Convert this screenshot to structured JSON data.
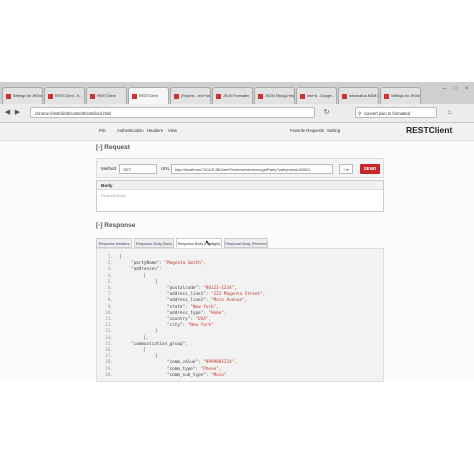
{
  "browser": {
    "tabs": [
      {
        "label": "Settings for JROdem"
      },
      {
        "label": "RESTClient - fi..."
      },
      {
        "label": "RESTClient"
      },
      {
        "label": "RESTClient"
      },
      {
        "label": "(Rs)sms - rest+hasin"
      },
      {
        "label": "JSON Formatter"
      },
      {
        "label": "JSON Strong-Help"
      },
      {
        "label": "rest+d - Google..."
      },
      {
        "label": "Informatica MDM Hub"
      },
      {
        "label": "Settings for JROdem"
      }
    ],
    "url": "chrome://restclient/content/restclient.html",
    "search": "convert json to formatted"
  },
  "appbar": {
    "menus": [
      "File",
      "Authentication",
      "Headers",
      "View"
    ],
    "right_menus": [
      "Favorite Requests",
      "Setting"
    ],
    "brand": "RESTClient"
  },
  "request": {
    "section_title": "[-] Request",
    "method_label": "Method",
    "method_value": "GET",
    "url_label": "URL",
    "url_value": "http://localhost:7001/EJBClientTest/rest/services/getParty?partyrowid=60001",
    "send_label": "SEND",
    "body_label": "Body",
    "body_placeholder": "Request Body"
  },
  "response": {
    "section_title": "[-] Response",
    "tabs": [
      "Response Headers",
      "Response Body (Raw)",
      "Response Body (Highlight)",
      "Response Body (Preview)"
    ],
    "active_tab": 2,
    "lines": [
      {
        "n": "1.",
        "indent": 0,
        "key": "{",
        "val": ""
      },
      {
        "n": "2.",
        "indent": 1,
        "key": "\"partyName\": ",
        "val": "\"Magenta Smith\","
      },
      {
        "n": "3.",
        "indent": 1,
        "key": "\"addresses\":",
        "val": ""
      },
      {
        "n": "4.",
        "indent": 2,
        "key": "[",
        "val": ""
      },
      {
        "n": "5.",
        "indent": 3,
        "key": "{",
        "val": ""
      },
      {
        "n": "6.",
        "indent": 4,
        "key": "\"postalcode\": ",
        "val": "\"90123-1234\","
      },
      {
        "n": "7.",
        "indent": 4,
        "key": "\"address_line1\": ",
        "val": "\"222 Magenta Street\","
      },
      {
        "n": "8.",
        "indent": 4,
        "key": "\"address_line2\": ",
        "val": "\"Main Avenue\","
      },
      {
        "n": "9.",
        "indent": 4,
        "key": "\"state\": ",
        "val": "\"New York\","
      },
      {
        "n": "10.",
        "indent": 4,
        "key": "\"address_type\": ",
        "val": "\"Home\","
      },
      {
        "n": "11.",
        "indent": 4,
        "key": "\"country\": ",
        "val": "\"USA\","
      },
      {
        "n": "12.",
        "indent": 4,
        "key": "\"city\": ",
        "val": "\"New York\""
      },
      {
        "n": "13.",
        "indent": 3,
        "key": "}",
        "val": ""
      },
      {
        "n": "14.",
        "indent": 2,
        "key": "],",
        "val": ""
      },
      {
        "n": "15.",
        "indent": 1,
        "key": "\"communication_group\":",
        "val": ""
      },
      {
        "n": "16.",
        "indent": 2,
        "key": "[",
        "val": ""
      },
      {
        "n": "17.",
        "indent": 3,
        "key": "{",
        "val": ""
      },
      {
        "n": "18.",
        "indent": 4,
        "key": "\"comm_value\": ",
        "val": "\"9999881234\","
      },
      {
        "n": "19.",
        "indent": 4,
        "key": "\"comm_type\": ",
        "val": "\"Phone\","
      },
      {
        "n": "20.",
        "indent": 4,
        "key": "\"comm_sub_type\": ",
        "val": "\"Main\""
      }
    ]
  },
  "colors": {
    "send": "#c62828",
    "string_value": "#c0392b"
  }
}
